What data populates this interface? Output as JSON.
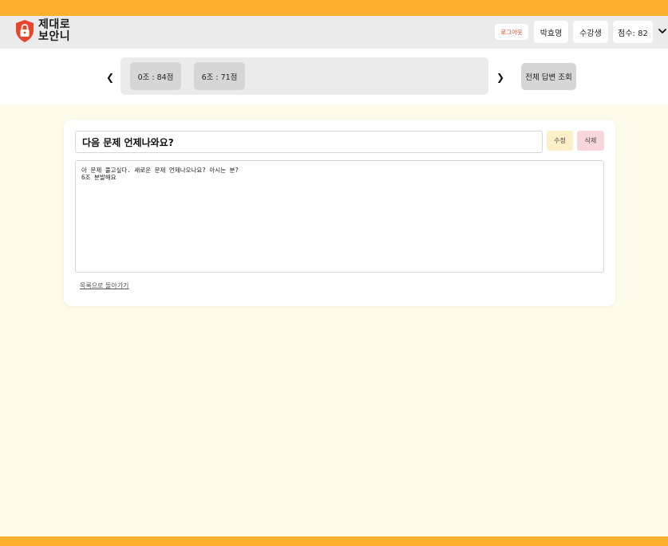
{
  "app": {
    "logo_line1": "제대로",
    "logo_line2": "보안니",
    "brand_color": "#ffb02e",
    "logo_color": "#e8462c"
  },
  "header": {
    "logout_label": "로그아웃",
    "user_name": "박효영",
    "role": "수강생",
    "score": "점수: 82"
  },
  "groups": {
    "tabs": [
      {
        "label": "0조 : 84점"
      },
      {
        "label": "6조 : 71점"
      }
    ],
    "all_answers_label": "전체 답변 조회",
    "prev_label": "❮",
    "next_label": "❯"
  },
  "post": {
    "title": "다음 문제 언제나와요?",
    "edit_label": "수정",
    "delete_label": "삭제",
    "body": "아 문제 풀고싶다. 새로운 문제 언제나오나요? 아시는 분?\n6조 분발해요",
    "back_label": "목록으로 돌아가기"
  }
}
